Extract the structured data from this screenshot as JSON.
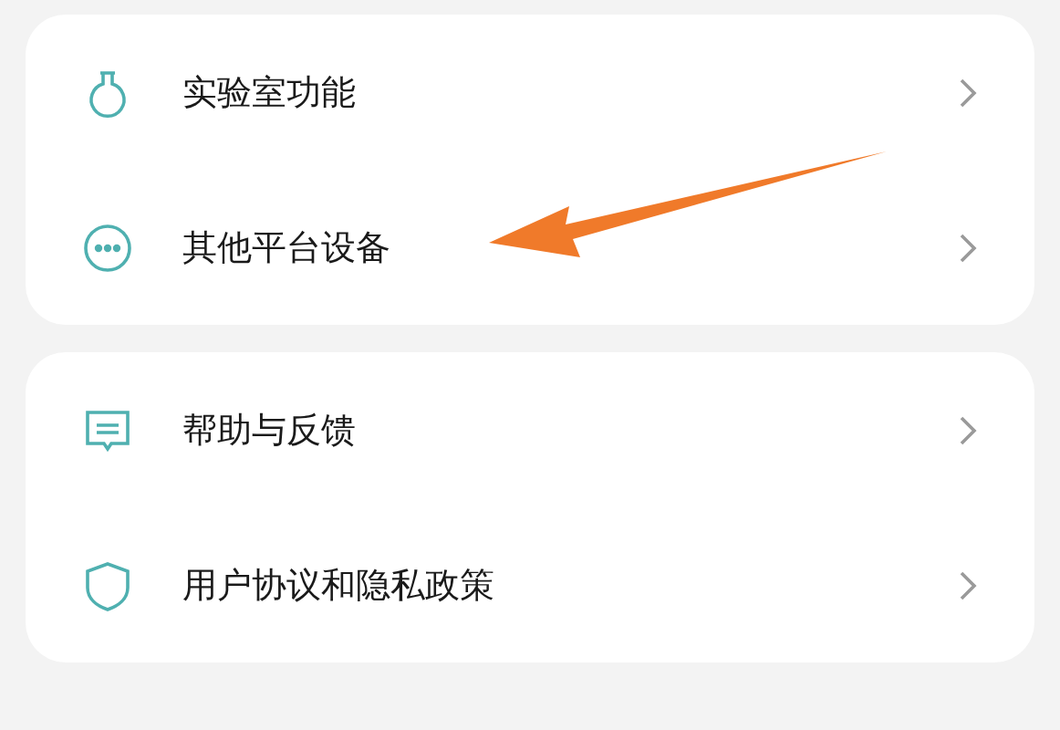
{
  "groups": [
    {
      "items": [
        {
          "kind": "lab",
          "label": "实验室功能"
        },
        {
          "kind": "devices",
          "label": "其他平台设备"
        }
      ]
    },
    {
      "items": [
        {
          "kind": "feedback",
          "label": "帮助与反馈"
        },
        {
          "kind": "privacy",
          "label": "用户协议和隐私政策"
        }
      ]
    }
  ]
}
